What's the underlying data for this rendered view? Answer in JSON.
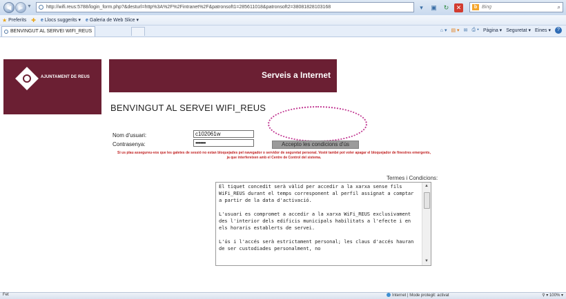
{
  "browser": {
    "url": "http://wifi.reus:5788/login_form.php?&desturl=http%3A%2F%2Fintranet%2F&patronsoft1=285611018&patronsoft2=38081828103168",
    "search_placeholder": "Bing",
    "favorites": {
      "preferits": "Preferits",
      "suggested_sites": "Llocs suggerits ▾",
      "web_slice": "Galeria de Web Slice ▾"
    },
    "tab_title": "BENVINGUT AL SERVEI WIFI_REUS",
    "commands": {
      "page": "Pàgina ▾",
      "security": "Seguretat ▾",
      "tools": "Eines ▾"
    },
    "status": {
      "left": "Fet",
      "zone": "Internet | Mode protegit: activat",
      "zoom": "100%"
    }
  },
  "page": {
    "logo_text": "AJUNTAMENT DE REUS",
    "banner_title": "Serveis a Internet",
    "welcome": "BENVINGUT AL SERVEI WIFI_REUS",
    "form": {
      "user_label": "Nom d'usuari:",
      "user_value": "c102061w",
      "pass_label": "Contrasenya:",
      "pass_value": "••••••••",
      "accept_button": "Accepto les condicions d'ús"
    },
    "note": "Si us plau assegureu-vos que les galetes de sessió no estan bloquejades pel navegador o servidor de seguretat personal. Vosté també pot voler apagar el bloquejador de finestres emergents, ja que interfereixen amb el Centre de Control del sistema.",
    "terms": {
      "title": "Termes i Condicions:",
      "p1": "El tiquet concedit serà vàlid per accedir a la xarxa sense fils WiFi_REUS durant el temps corresponent al perfil assignat a comptar a partir de la data d'activació.",
      "p2": "L'usuari es compromet a accedir a la xarxa WiFi_REUS exclusivament des l'interior dels edificis municipals habilitats a l'efecte i en els horaris establerts de servei.",
      "p3": "L'ús i l'accés serà estrictament personal; les claus d'accés hauran de ser custodiades personalment, no"
    }
  }
}
